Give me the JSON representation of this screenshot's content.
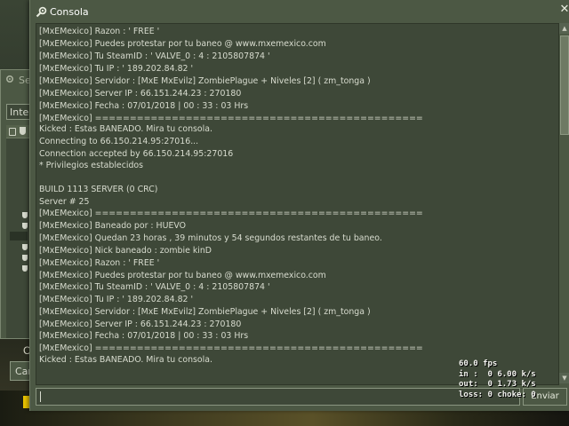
{
  "background": {
    "left_letters": [
      "C",
      "A"
    ]
  },
  "server_browser": {
    "title": "Se",
    "tab_label": "Intern",
    "button_label": "Can"
  },
  "console": {
    "title": "Consola",
    "close_glyph": "✕",
    "lines": [
      "[MxEMexico] Razon : ' FREE '",
      "[MxEMexico] Puedes protestar por tu baneo @ www.mxemexico.com",
      "[MxEMexico] Tu SteamID : ' VALVE_0 : 4 : 2105807874 '",
      "[MxEMexico] Tu IP : ' 189.202.84.82 '",
      "[MxEMexico] Servidor : [MxE MxEvilz] ZombiePlague + Niveles [2] ( zm_tonga )",
      "[MxEMexico] Server IP : 66.151.244.23 : 270180",
      "[MxEMexico] Fecha : 07/01/2018 | 00 : 33 : 03 Hrs",
      "[MxEMexico] ===============================================",
      "Kicked : Estas BANEADO. Mira tu consola.",
      "Connecting to 66.150.214.95:27016...",
      "Connection accepted by 66.150.214.95:27016",
      "* Privilegios establecidos",
      "",
      "BUILD 1113 SERVER (0 CRC)",
      "Server # 25",
      "[MxEMexico] ===============================================",
      "[MxEMexico] Baneado por : HUEVO",
      "[MxEMexico] Quedan 23 horas , 39 minutos y 54 segundos restantes de tu baneo.",
      "[MxEMexico] Nick baneado : zombie kinD",
      "[MxEMexico] Razon : ' FREE '",
      "[MxEMexico] Puedes protestar por tu baneo @ www.mxemexico.com",
      "[MxEMexico] Tu SteamID : ' VALVE_0 : 4 : 2105807874 '",
      "[MxEMexico] Tu IP : ' 189.202.84.82 '",
      "[MxEMexico] Servidor : [MxE MxEvilz] ZombiePlague + Niveles [2] ( zm_tonga )",
      "[MxEMexico] Server IP : 66.151.244.23 : 270180",
      "[MxEMexico] Fecha : 07/01/2018 | 00 : 33 : 03 Hrs",
      "[MxEMexico] ===============================================",
      "Kicked : Estas BANEADO. Mira tu consola."
    ],
    "command_value": "",
    "submit_label": "Enviar"
  },
  "netgraph": {
    "fps": "60.0 fps",
    "in": "in :  0 6.00 k/s",
    "out": "out:  0 1.73 k/s",
    "loss": "loss: 0 choke: 0"
  },
  "colors": {
    "panel": "#4c5844",
    "panel_dark": "#3e4838",
    "text": "#d8dccf",
    "title_text": "#ffffff"
  }
}
